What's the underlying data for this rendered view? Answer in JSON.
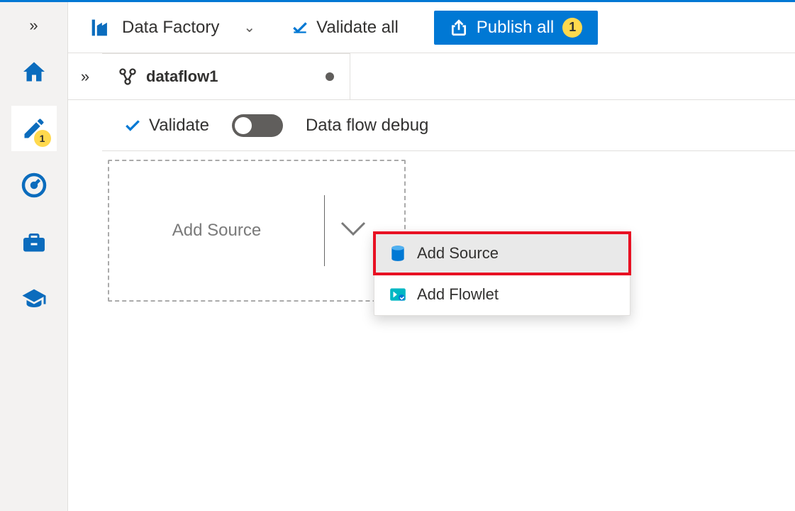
{
  "app": {
    "title": "Data Factory"
  },
  "toolbar": {
    "validate_all_label": "Validate all",
    "publish_all_label": "Publish all",
    "publish_badge": "1"
  },
  "nav": {
    "author_badge": "1"
  },
  "tabs": [
    {
      "label": "dataflow1",
      "dirty": true
    }
  ],
  "canvas_bar": {
    "validate_label": "Validate",
    "debug_label": "Data flow debug",
    "debug_on": false
  },
  "canvas": {
    "add_source_label": "Add Source"
  },
  "popup": {
    "items": [
      {
        "label": "Add Source",
        "highlighted": true
      },
      {
        "label": "Add Flowlet",
        "highlighted": false
      }
    ]
  }
}
